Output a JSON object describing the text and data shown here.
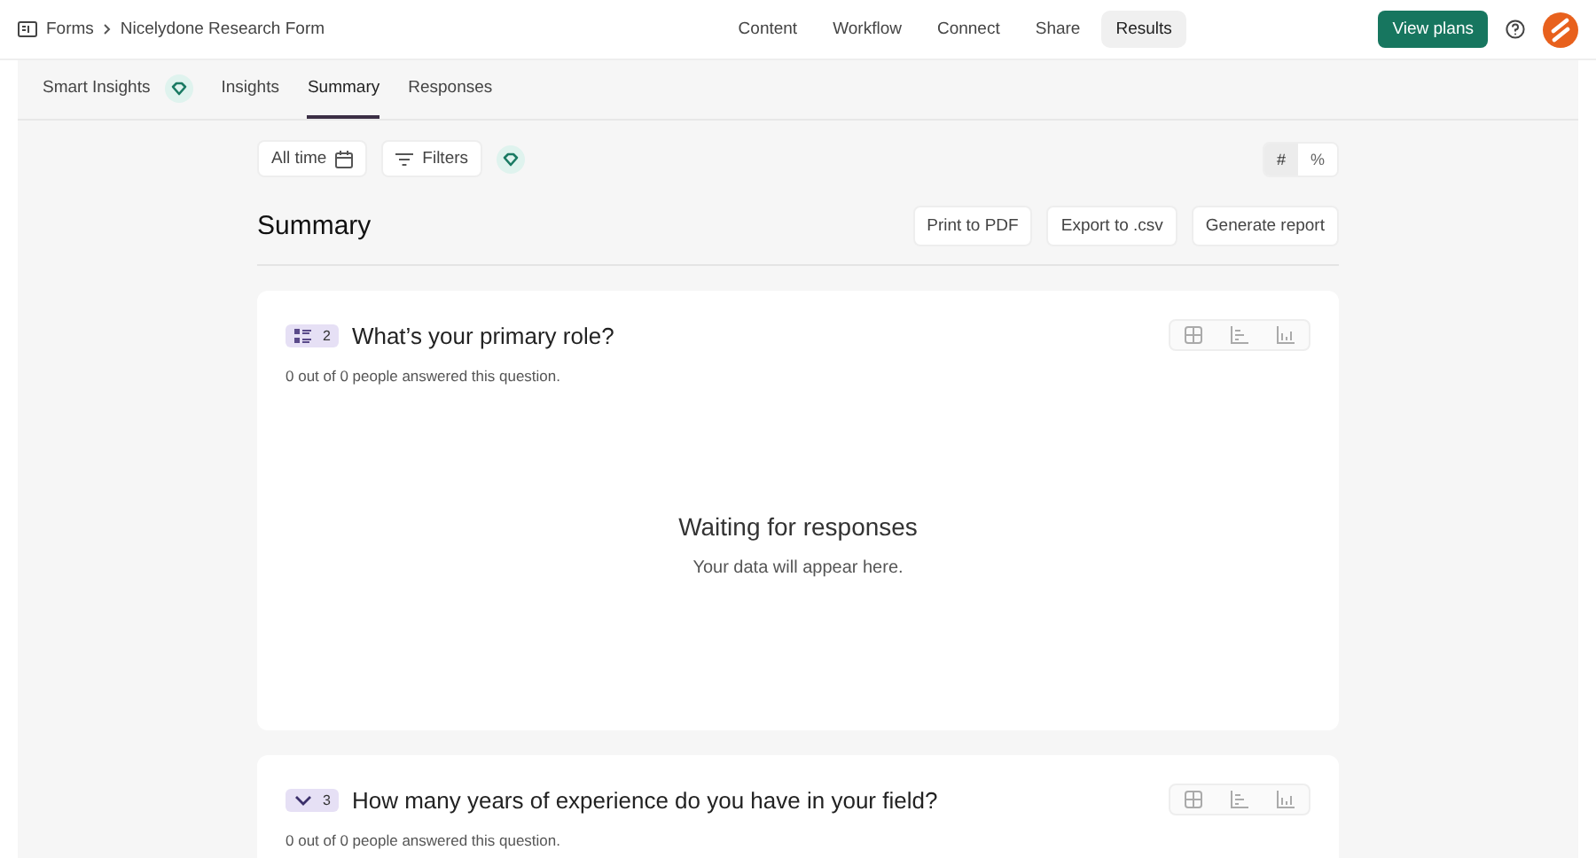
{
  "breadcrumb": [
    "Forms",
    "Nicelydone Research Form"
  ],
  "nav_tabs": [
    {
      "label": "Content",
      "selected": false
    },
    {
      "label": "Workflow",
      "selected": false
    },
    {
      "label": "Connect",
      "selected": false
    },
    {
      "label": "Share",
      "selected": false
    },
    {
      "label": "Results",
      "selected": true
    }
  ],
  "view_plans_button": "View plans",
  "sub_tabs": [
    {
      "label": "Smart Insights",
      "selected": false,
      "badge": true
    },
    {
      "label": "Insights",
      "selected": false,
      "badge": false
    },
    {
      "label": "Summary",
      "selected": true,
      "badge": false
    },
    {
      "label": "Responses",
      "selected": false,
      "badge": false
    }
  ],
  "filters": {
    "date_range": "All time",
    "filters_label": "Filters"
  },
  "number_format": [
    {
      "label": "#",
      "selected": true
    },
    {
      "label": "%",
      "selected": false
    }
  ],
  "summary": {
    "title": "Summary",
    "actions": [
      "Print to PDF",
      "Export to .csv",
      "Generate report"
    ]
  },
  "questions": [
    {
      "kind": "multiple-choice",
      "number": "2",
      "title": "What’s your primary role?",
      "answered": "0 out of 0 people answered this question.",
      "empty_title": "Waiting for responses",
      "empty_text": "Your data will appear here."
    },
    {
      "kind": "dropdown",
      "number": "3",
      "title": "How many years of experience do you have in your field?",
      "answered": "0 out of 0 people answered this question."
    }
  ]
}
